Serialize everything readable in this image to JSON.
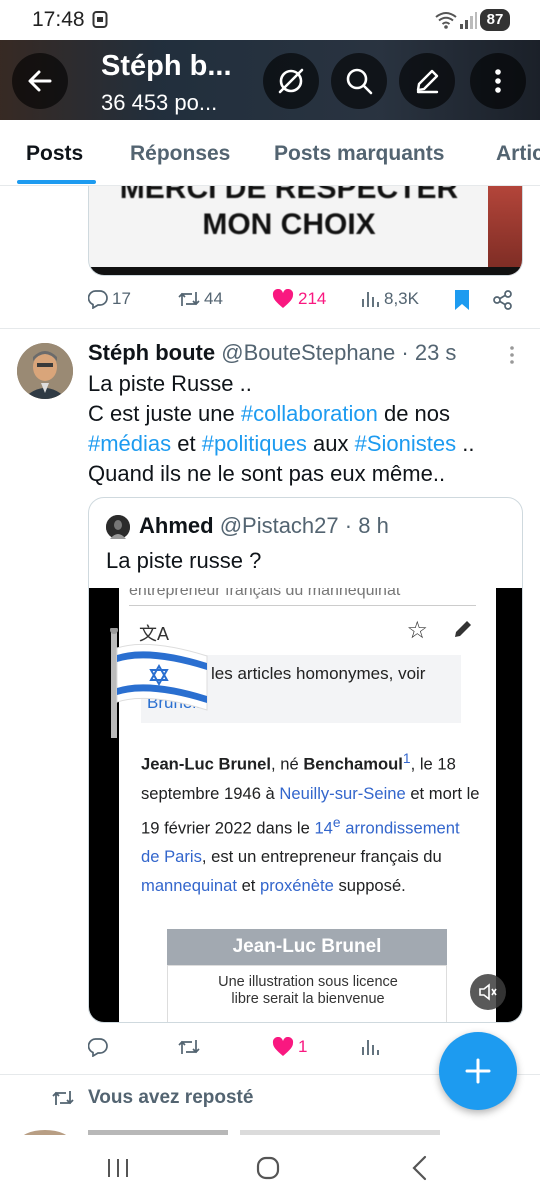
{
  "status_bar": {
    "time": "17:48",
    "battery": "87"
  },
  "header": {
    "title": "Stéph b...",
    "subtitle": "36 453 po..."
  },
  "tabs": [
    {
      "label": "Posts",
      "active": true
    },
    {
      "label": "Réponses",
      "active": false
    },
    {
      "label": "Posts marquants",
      "active": false
    },
    {
      "label": "Artic",
      "active": false
    }
  ],
  "post1": {
    "image_text_1": "MERCI DE RESPECTER",
    "image_text_2": "MON CHOIX",
    "replies": "17",
    "reposts": "44",
    "likes": "214",
    "views": "8,3K",
    "liked": true,
    "bookmarked": true
  },
  "post2": {
    "name": "Stéph boute",
    "handle": "@BouteStephane",
    "time": "23 s",
    "text": {
      "l1": "La piste Russe ..",
      "l2a": "C est juste une ",
      "tag1": "#collaboration",
      "l2b": " de nos",
      "tag2": "#médias",
      "l3a": " et ",
      "tag3": "#politiques",
      "l3b": " aux ",
      "tag4": "#Sionistes",
      "l3c": " ..",
      "l4": "Quand ils ne le sont pas eux même.."
    },
    "quote": {
      "name": "Ahmed",
      "handle": "@Pistach27",
      "time": "8 h",
      "text": "La piste russe ?",
      "wiki": {
        "top_line": "entrepreneur français du mannequinat",
        "hatnote_1": "les articles homonymes, voir",
        "hatnote_2": "Brunel.",
        "p_bold_name": "Jean-Luc Brunel",
        "p_1": ", né ",
        "p_bold_born": "Benchamoul",
        "p_sup": "1",
        "p_2": ", le 18 septembre 1946 à ",
        "p_link_1": "Neuilly-sur-Seine",
        "p_3": " et mort le 19 février 2022 dans le ",
        "p_link_2a": "14",
        "p_link_2_sup": "e",
        "p_link_2b": " arrondissement de Paris",
        "p_4": ", est un entrepreneur français du ",
        "p_link_3": "mannequinat",
        "p_5": " et ",
        "p_link_4": "proxénète",
        "p_6": " supposé.",
        "infobox_title": "Jean-Luc Brunel",
        "infobox_line_1": "Une illustration sous licence",
        "infobox_line_2": "libre serait la bienvenue"
      }
    },
    "replies": "",
    "reposts": "",
    "likes": "1",
    "liked": true
  },
  "repost_label": "Vous avez reposté",
  "colors": {
    "accent": "#1d9bf0",
    "like": "#f91880",
    "text": "#0f1419",
    "muted": "#536471"
  }
}
